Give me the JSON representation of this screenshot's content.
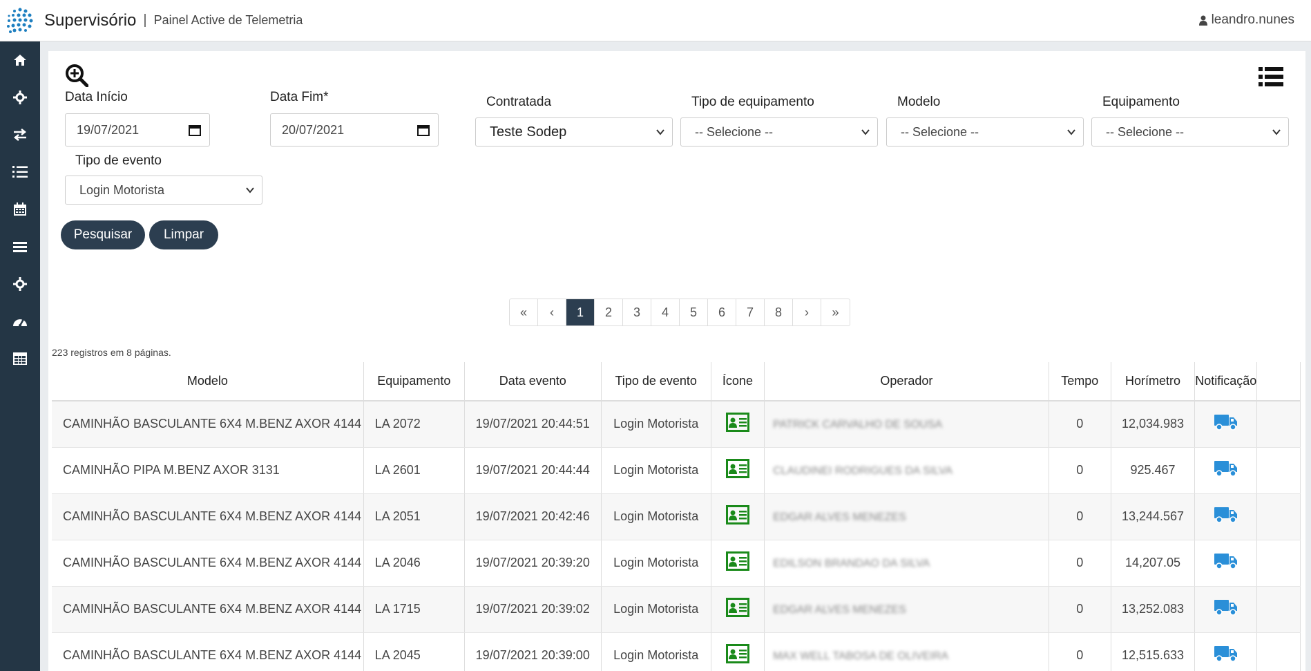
{
  "header": {
    "brand": "Supervisório",
    "separator": "|",
    "subtitle": "Painel Active de Telemetria",
    "user": "leandro.nunes"
  },
  "sidebar": {
    "items": [
      {
        "name": "home",
        "icon": "home-icon"
      },
      {
        "name": "crosshair",
        "icon": "crosshair-icon"
      },
      {
        "name": "exchange",
        "icon": "exchange-icon"
      },
      {
        "name": "list-ordered",
        "icon": "list-ordered-icon"
      },
      {
        "name": "calendar",
        "icon": "calendar-icon"
      },
      {
        "name": "menu",
        "icon": "menu-icon"
      },
      {
        "name": "crosshair-2",
        "icon": "crosshair-icon"
      },
      {
        "name": "dashboard",
        "icon": "dashboard-icon"
      },
      {
        "name": "table",
        "icon": "table-icon"
      }
    ]
  },
  "filters": {
    "data_inicio_label": "Data Início",
    "data_inicio_value": "19/07/2021",
    "data_fim_label": "Data Fim*",
    "data_fim_value": "20/07/2021",
    "contratada_label": "Contratada",
    "contratada_value": "Teste Sodep",
    "tipo_equip_label": "Tipo de equipamento",
    "tipo_equip_value": "-- Selecione --",
    "modelo_label": "Modelo",
    "modelo_value": "-- Selecione --",
    "equipamento_label": "Equipamento",
    "equipamento_value": "-- Selecione --",
    "tipo_evento_label": "Tipo de evento",
    "tipo_evento_value": "Login Motorista"
  },
  "buttons": {
    "pesquisar": "Pesquisar",
    "limpar": "Limpar"
  },
  "pagination": {
    "first": "«",
    "prev": "‹",
    "pages": [
      "1",
      "2",
      "3",
      "4",
      "5",
      "6",
      "7",
      "8"
    ],
    "active": "1",
    "next": "›",
    "last": "»"
  },
  "records_info": "223 registros em 8 páginas.",
  "table": {
    "columns": [
      "Modelo",
      "Equipamento",
      "Data evento",
      "Tipo de evento",
      "Ícone",
      "Operador",
      "Tempo",
      "Horímetro",
      "Notificação"
    ],
    "rows": [
      {
        "modelo": "CAMINHÃO BASCULANTE 6X4 M.BENZ AXOR 4144",
        "equipamento": "LA 2072",
        "data": "19/07/2021 20:44:51",
        "tipo": "Login Motorista",
        "operador": "PATRICK CARVALHO DE SOUSA",
        "tempo": "0",
        "horimetro": "12,034.983"
      },
      {
        "modelo": "CAMINHÃO PIPA M.BENZ AXOR 3131",
        "equipamento": "LA 2601",
        "data": "19/07/2021 20:44:44",
        "tipo": "Login Motorista",
        "operador": "CLAUDINEI RODRIGUES DA SILVA",
        "tempo": "0",
        "horimetro": "925.467"
      },
      {
        "modelo": "CAMINHÃO BASCULANTE 6X4 M.BENZ AXOR 4144",
        "equipamento": "LA 2051",
        "data": "19/07/2021 20:42:46",
        "tipo": "Login Motorista",
        "operador": "EDGAR ALVES MENEZES",
        "tempo": "0",
        "horimetro": "13,244.567"
      },
      {
        "modelo": "CAMINHÃO BASCULANTE 6X4 M.BENZ AXOR 4144",
        "equipamento": "LA 2046",
        "data": "19/07/2021 20:39:20",
        "tipo": "Login Motorista",
        "operador": "EDILSON BRANDAO DA SILVA",
        "tempo": "0",
        "horimetro": "14,207.05"
      },
      {
        "modelo": "CAMINHÃO BASCULANTE 6X4 M.BENZ AXOR 4144",
        "equipamento": "LA 1715",
        "data": "19/07/2021 20:39:02",
        "tipo": "Login Motorista",
        "operador": "EDGAR ALVES MENEZES",
        "tempo": "0",
        "horimetro": "13,252.083"
      },
      {
        "modelo": "CAMINHÃO BASCULANTE 6X4 M.BENZ AXOR 4144",
        "equipamento": "LA 2045",
        "data": "19/07/2021 20:39:00",
        "tipo": "Login Motorista",
        "operador": "MAX WELL TABOSA DE OLIVEIRA",
        "tempo": "0",
        "horimetro": "12,515.633"
      }
    ]
  },
  "colors": {
    "sidebar": "#243645",
    "button": "#2c3e50",
    "icon_green": "#1a8a1a",
    "truck_blue": "#2a8fd8"
  }
}
